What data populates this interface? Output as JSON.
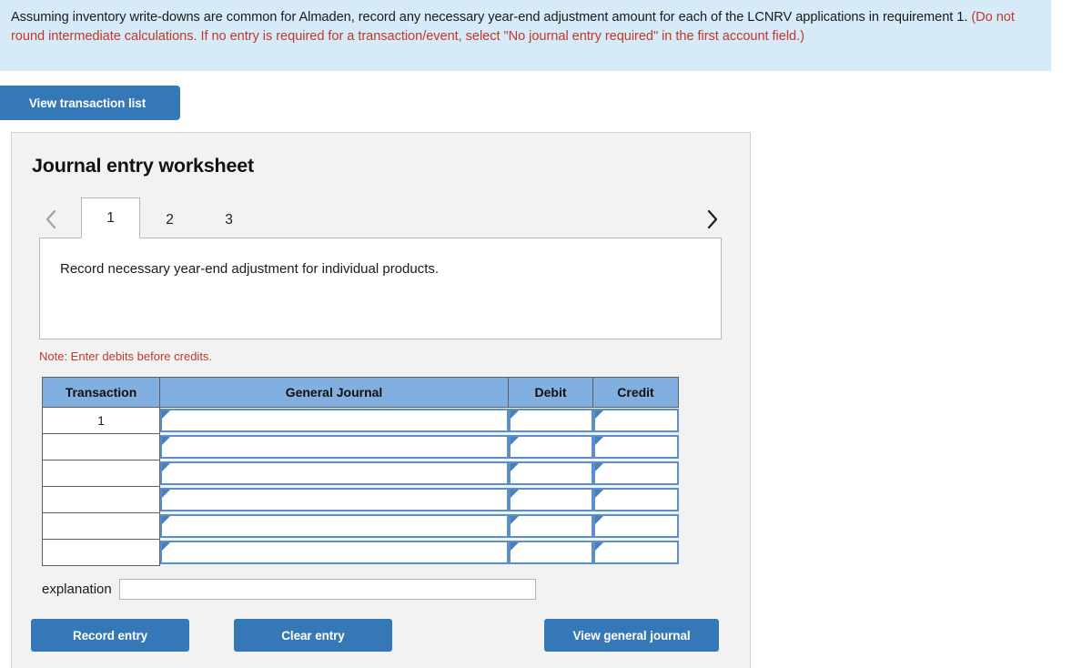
{
  "instruction": {
    "main_text": "Assuming inventory write-downs are common for Almaden, record any necessary year-end adjustment amount for each of the LCNRV applications in requirement 1. ",
    "note_text": "(Do not round intermediate calculations. If no entry is required for a transaction/event, select \"No journal entry required\" in the first account field.)"
  },
  "toolbar": {
    "view_transaction_list_label": "View transaction list"
  },
  "worksheet": {
    "title": "Journal entry worksheet",
    "tabs": [
      {
        "label": "1",
        "active": true
      },
      {
        "label": "2",
        "active": false
      },
      {
        "label": "3",
        "active": false
      }
    ],
    "prev_icon": "chevron-left-icon",
    "next_icon": "chevron-right-icon",
    "description": "Record necessary year-end adjustment for individual products.",
    "note": "Note: Enter debits before credits.",
    "table": {
      "columns": [
        "Transaction",
        "General Journal",
        "Debit",
        "Credit"
      ],
      "rows": [
        {
          "transaction": "1",
          "general_journal": "",
          "debit": "",
          "credit": ""
        },
        {
          "transaction": "",
          "general_journal": "",
          "debit": "",
          "credit": ""
        },
        {
          "transaction": "",
          "general_journal": "",
          "debit": "",
          "credit": ""
        },
        {
          "transaction": "",
          "general_journal": "",
          "debit": "",
          "credit": ""
        },
        {
          "transaction": "",
          "general_journal": "",
          "debit": "",
          "credit": ""
        },
        {
          "transaction": "",
          "general_journal": "",
          "debit": "",
          "credit": ""
        }
      ]
    },
    "explanation": {
      "label": "explanation",
      "value": "",
      "placeholder": ""
    },
    "actions": {
      "record_entry_label": "Record entry",
      "clear_entry_label": "Clear entry",
      "view_general_journal_label": "View general journal"
    }
  },
  "colors": {
    "banner_background": "#d6eaf8",
    "accent_red": "#c0392b",
    "button_blue": "#3578b8",
    "table_header_blue": "#80afe0",
    "entry_border_blue": "#5b8fc9",
    "panel_background": "#f2f2f2"
  }
}
